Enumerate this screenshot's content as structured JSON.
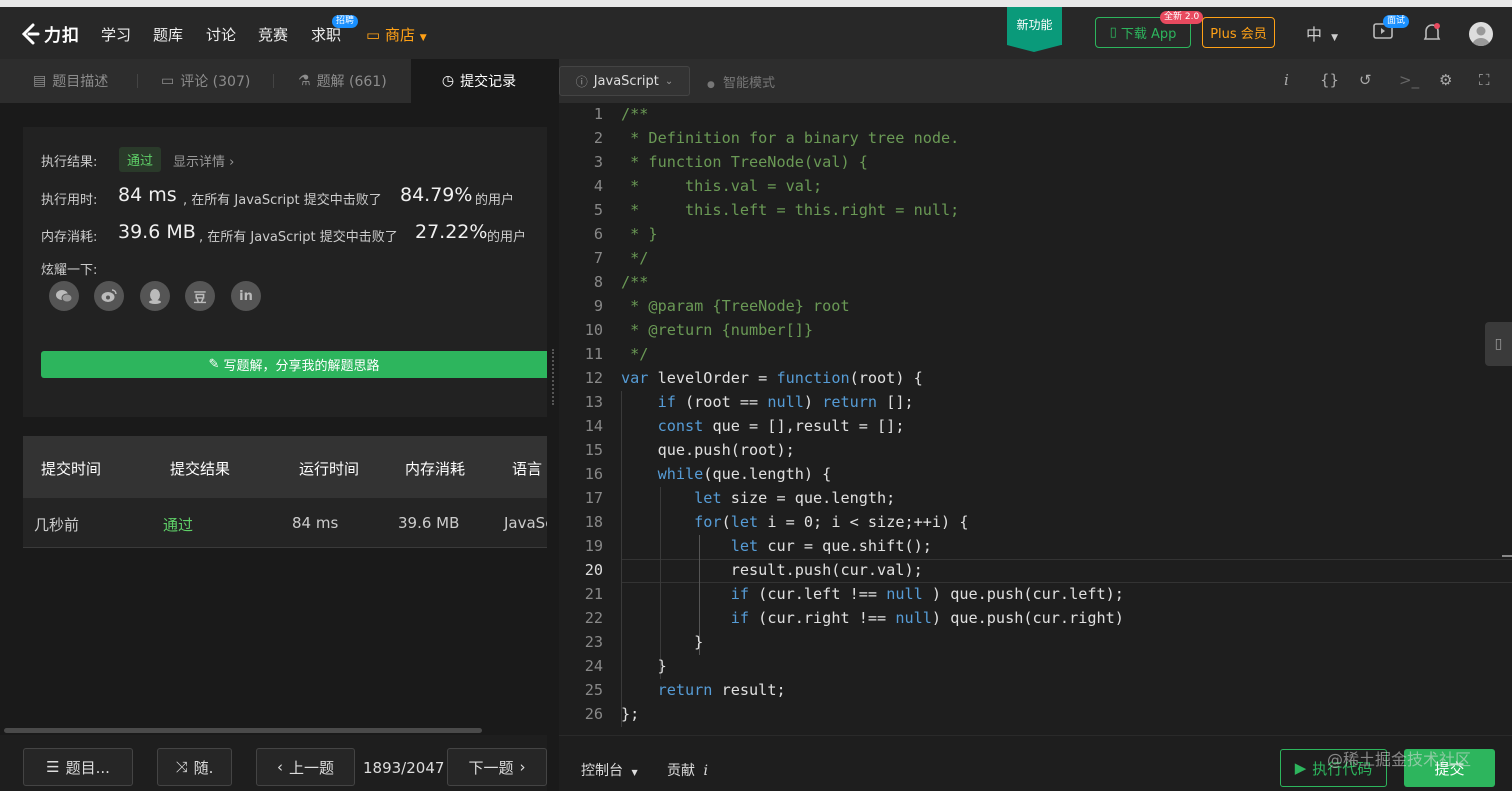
{
  "header": {
    "logo_text": "力扣",
    "nav": [
      {
        "label": "学习"
      },
      {
        "label": "题库"
      },
      {
        "label": "讨论"
      },
      {
        "label": "竞赛"
      },
      {
        "label": "求职",
        "badge": "招聘"
      }
    ],
    "store_label": "商店",
    "new_feature": "新功能",
    "download_app": "下载 App",
    "download_badge": "全新 2.0",
    "plus": "Plus 会员",
    "lang": "中",
    "interview_badge": "面试"
  },
  "left": {
    "tabs": [
      {
        "label": "题目描述"
      },
      {
        "label": "评论 (307)"
      },
      {
        "label": "题解 (661)"
      },
      {
        "label": "提交记录"
      }
    ],
    "result": {
      "exec_label": "执行结果:",
      "status": "通过",
      "details": "显示详情 ›",
      "time_label": "执行用时:",
      "time_value": "84 ms",
      "time_mid": ", 在所有 JavaScript 提交中击败了",
      "time_pct": "84.79%",
      "time_suffix": "的用户",
      "mem_label": "内存消耗:",
      "mem_value": "39.6 MB",
      "mem_mid": ", 在所有 JavaScript 提交中击败了",
      "mem_pct": "27.22%",
      "mem_suffix": "的用户",
      "share_label": "炫耀一下:",
      "share_icons": [
        "wechat-icon",
        "weibo-icon",
        "qq-icon",
        "douban-icon",
        "linkedin-icon"
      ],
      "share_glyph_douban": "豆",
      "share_glyph_linkedin": "in",
      "write_solution": "写题解，分享我的解题思路"
    },
    "table": {
      "headers": [
        "提交时间",
        "提交结果",
        "运行时间",
        "内存消耗",
        "语言"
      ],
      "rows": [
        {
          "time": "几秒前",
          "result": "通过",
          "runtime": "84 ms",
          "memory": "39.6 MB",
          "lang": "JavaScript"
        }
      ]
    },
    "bottom": {
      "problems": "题目...",
      "random": "随.",
      "prev": "上一题",
      "position": "1893/2047",
      "next": "下一题"
    }
  },
  "editor": {
    "language": "JavaScript",
    "smart_mode": "智能模式",
    "current_line": 20,
    "lines": [
      "/**",
      " * Definition for a binary tree node.",
      " * function TreeNode(val) {",
      " *     this.val = val;",
      " *     this.left = this.right = null;",
      " * }",
      " */",
      "/**",
      " * @param {TreeNode} root",
      " * @return {number[]}",
      " */",
      "var levelOrder = function(root) {",
      "    if (root == null) return [];",
      "    const que = [],result = [];",
      "    que.push(root);",
      "    while(que.length) {",
      "        let size = que.length;",
      "        for(let i = 0; i < size;++i) {",
      "            let cur = que.shift();",
      "            result.push(cur.val);",
      "            if (cur.left !== null ) que.push(cur.left);",
      "            if (cur.right !== null) que.push(cur.right)",
      "        }",
      "    }",
      "    return result;",
      "};"
    ],
    "bottom": {
      "console": "控制台",
      "contribute": "贡献",
      "run": "执行代码",
      "submit": "提交",
      "watermark": "@稀土掘金技术社区"
    }
  }
}
